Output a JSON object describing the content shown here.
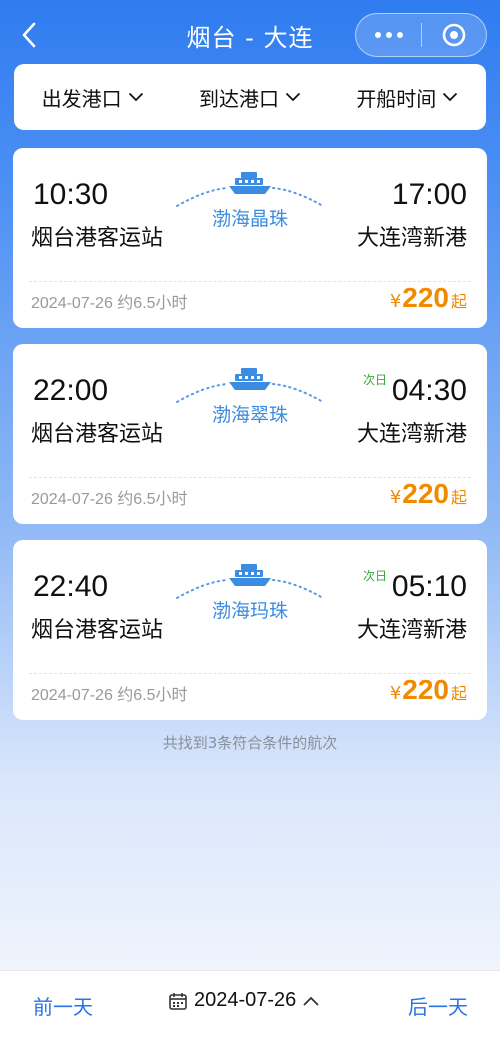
{
  "header": {
    "title": "烟台 - 大连"
  },
  "filters": [
    {
      "label": "出发港口"
    },
    {
      "label": "到达港口"
    },
    {
      "label": "开船时间"
    }
  ],
  "voyages": [
    {
      "dep_time": "10:30",
      "dep_port": "烟台港客运站",
      "ship_name": "渤海晶珠",
      "next_day": "",
      "arr_time": "17:00",
      "arr_port": "大连湾新港",
      "meta": "2024-07-26 约6.5小时",
      "currency": "¥",
      "price": "220",
      "price_suffix": "起"
    },
    {
      "dep_time": "22:00",
      "dep_port": "烟台港客运站",
      "ship_name": "渤海翠珠",
      "next_day": "次日",
      "arr_time": "04:30",
      "arr_port": "大连湾新港",
      "meta": "2024-07-26 约6.5小时",
      "currency": "¥",
      "price": "220",
      "price_suffix": "起"
    },
    {
      "dep_time": "22:40",
      "dep_port": "烟台港客运站",
      "ship_name": "渤海玛珠",
      "next_day": "次日",
      "arr_time": "05:10",
      "arr_port": "大连湾新港",
      "meta": "2024-07-26 约6.5小时",
      "currency": "¥",
      "price": "220",
      "price_suffix": "起"
    }
  ],
  "summary": "共找到3条符合条件的航次",
  "bottom": {
    "prev_label": "前一天",
    "date": "2024-07-26",
    "next_label": "后一天"
  },
  "colors": {
    "accent": "#2a73e8",
    "price": "#f08a00",
    "next_day": "#3aa53a",
    "ship_name": "#3a8de0"
  }
}
